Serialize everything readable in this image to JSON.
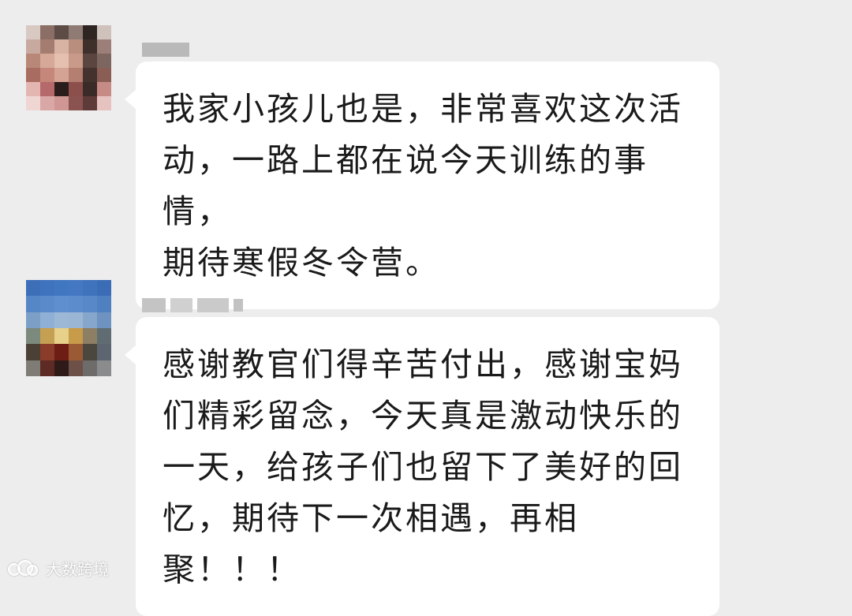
{
  "messages": [
    {
      "text": "我家小孩儿也是，非常喜欢这次活\n动，一路上都在说今天训练的事情，\n期待寒假冬令营。"
    },
    {
      "text": "感谢教官们得辛苦付出，感谢宝妈\n们精彩留念，今天真是激动快乐的\n一天，给孩子们也留下了美好的回\n忆，期待下一次相遇，再相聚！！！"
    }
  ],
  "watermark": {
    "text": "大数跨境"
  },
  "colors": {
    "background": "#ededed",
    "bubble": "#ffffff",
    "text": "#1a1a1a"
  }
}
